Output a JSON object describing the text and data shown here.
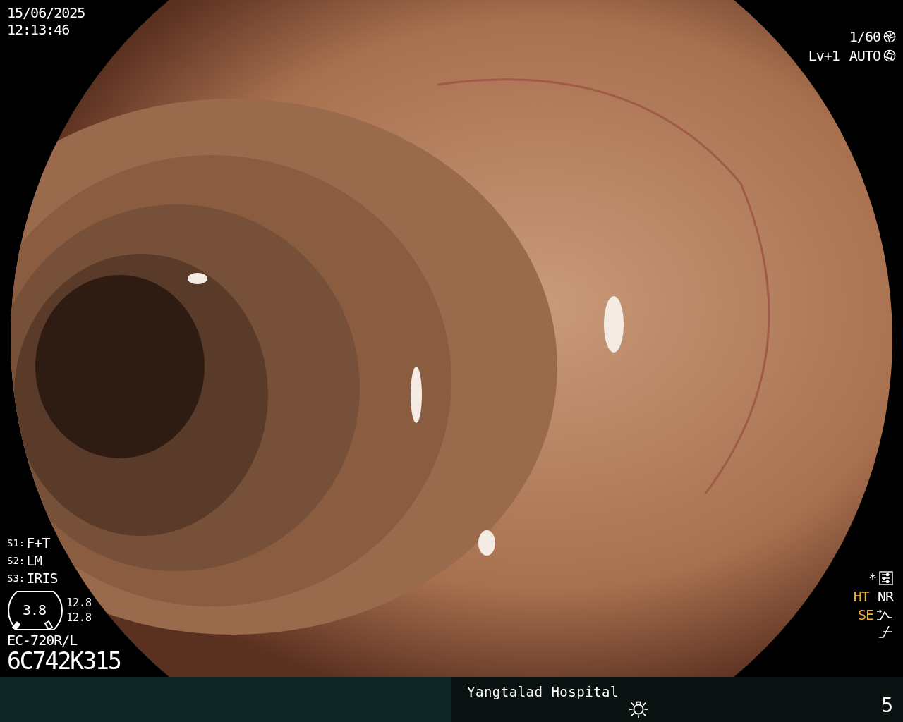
{
  "date": "15/06/2025",
  "time": "12:13:46",
  "exposure": {
    "shutter": "1/60",
    "light_level": "Lv+1",
    "iris_mode": "AUTO"
  },
  "switches": [
    {
      "key": "S1:",
      "value": "F+T"
    },
    {
      "key": "S2:",
      "value": "LM"
    },
    {
      "key": "S3:",
      "value": "IRIS"
    }
  ],
  "gauge": {
    "value": "3.8",
    "readings": [
      "12.8",
      "12.8"
    ]
  },
  "scope_model": "EC-720R/L",
  "serial": "6C742K315",
  "indicators": {
    "star": "*",
    "modes": [
      {
        "text": "HT",
        "color": "#f0b428"
      },
      {
        "text": "NR",
        "color": "#ffffff"
      }
    ],
    "enhancement": {
      "text": "SE",
      "color": "#f0b428"
    }
  },
  "footer": {
    "hospital": "Yangtalad Hospital",
    "page": "5"
  }
}
